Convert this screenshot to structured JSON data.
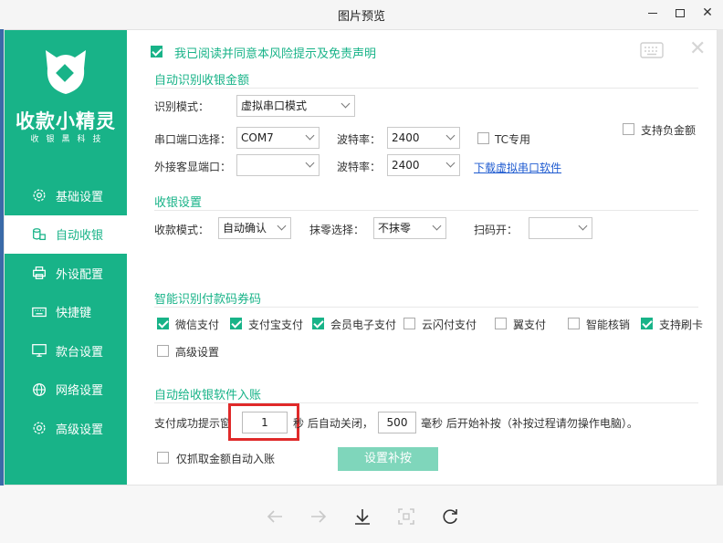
{
  "viewer": {
    "title": "图片预览",
    "bottom_buttons": [
      "prev-arrow",
      "next-arrow",
      "download",
      "fit-screen",
      "rotate"
    ]
  },
  "app": {
    "name": "收款小精灵",
    "subtitle": "收银黑科技",
    "agree_text": "我已阅读并同意本风险提示及免责声明",
    "accent_color": "#18b388"
  },
  "nav": {
    "items": [
      {
        "label": "基础设置",
        "icon": "gear-icon"
      },
      {
        "label": "自动收银",
        "icon": "coins-icon"
      },
      {
        "label": "外设配置",
        "icon": "printer-icon"
      },
      {
        "label": "快捷键",
        "icon": "keyboard-icon"
      },
      {
        "label": "款台设置",
        "icon": "monitor-icon"
      },
      {
        "label": "网络设置",
        "icon": "globe-icon"
      },
      {
        "label": "高级设置",
        "icon": "gear-icon"
      }
    ]
  },
  "section1": {
    "title": "自动识别收银金额",
    "mode_label": "识别模式：",
    "mode_value": "虚拟串口模式",
    "port_label": "串口端口选择：",
    "port_value": "COM7",
    "baud_label": "波特率：",
    "baud_value": "2400",
    "tc_label": "TC专用",
    "negative_label": "支持负金额",
    "ext_port_label": "外接客显端口：",
    "ext_port_value": "",
    "baud2_label": "波特率：",
    "baud2_value": "2400",
    "download_link": "下载虚拟串口软件"
  },
  "section2": {
    "title": "收银设置",
    "collect_label": "收款模式：",
    "collect_value": "自动确认",
    "round_label": "抹零选择：",
    "round_value": "不抹零",
    "scan_label": "扫码开：",
    "scan_value": ""
  },
  "section3": {
    "title": "智能识别付款码券码",
    "options": [
      {
        "label": "微信支付",
        "checked": true
      },
      {
        "label": "支付宝支付",
        "checked": true
      },
      {
        "label": "会员电子支付",
        "checked": true
      },
      {
        "label": "云闪付支付",
        "checked": false
      },
      {
        "label": "翼支付",
        "checked": false
      },
      {
        "label": "智能核销",
        "checked": false
      },
      {
        "label": "支持刷卡",
        "checked": true
      },
      {
        "label": "高级设置",
        "checked": false
      }
    ]
  },
  "section4": {
    "title": "自动给收银软件入账",
    "tip_prefix": "支付成功提示窗",
    "seconds_value": "1",
    "tip_mid": "秒 后自动关闭，",
    "ms_value": "500",
    "tip_suffix": "毫秒 后开始补按（补按过程请勿操作电脑）。",
    "only_amount_label": "仅抓取金额自动入账",
    "set_button": "设置补按"
  }
}
